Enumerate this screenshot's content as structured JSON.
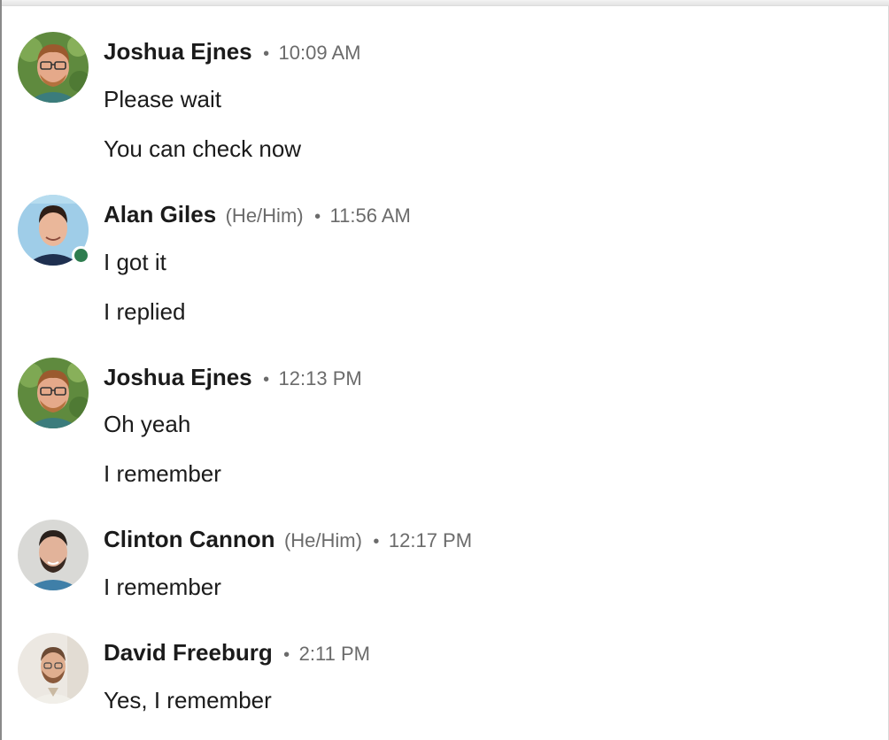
{
  "messages": [
    {
      "sender": "Joshua Ejnes",
      "pronouns": "",
      "separator": "•",
      "time": "10:09 AM",
      "avatar_icon": "person-avatar-glasses",
      "online": false,
      "lines": [
        "Please wait",
        "You can check now"
      ]
    },
    {
      "sender": "Alan Giles",
      "pronouns": "(He/Him)",
      "separator": "•",
      "time": "11:56 AM",
      "avatar_icon": "person-avatar",
      "online": true,
      "lines": [
        "I got it",
        "I replied"
      ]
    },
    {
      "sender": "Joshua Ejnes",
      "pronouns": "",
      "separator": "•",
      "time": "12:13 PM",
      "avatar_icon": "person-avatar-glasses",
      "online": false,
      "lines": [
        "Oh yeah",
        "I remember"
      ]
    },
    {
      "sender": "Clinton Cannon",
      "pronouns": "(He/Him)",
      "separator": "•",
      "time": "12:17 PM",
      "avatar_icon": "person-avatar-beard",
      "online": false,
      "lines": [
        "I remember"
      ]
    },
    {
      "sender": "David Freeburg",
      "pronouns": "",
      "separator": "•",
      "time": "2:11 PM",
      "avatar_icon": "person-avatar-beard",
      "online": false,
      "lines": [
        "Yes, I remember"
      ]
    }
  ],
  "colors": {
    "name": "#1b1b1b",
    "meta": "#6b6b6b",
    "online_status": "#2e7d4f"
  }
}
